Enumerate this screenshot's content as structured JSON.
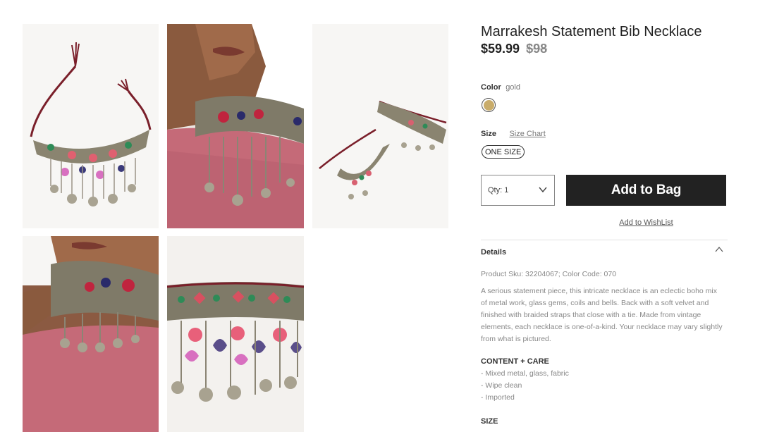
{
  "product": {
    "title": "Marrakesh Statement Bib Necklace",
    "price": "$59.99",
    "original_price": "$98"
  },
  "color": {
    "label": "Color",
    "selected": "gold",
    "swatch_hex": "#c9ac6a"
  },
  "size": {
    "label": "Size",
    "chart_link": "Size Chart",
    "option": "ONE SIZE"
  },
  "purchase": {
    "qty_label": "Qty: 1",
    "add_button": "Add to Bag",
    "wishlist_link": "Add to WishList"
  },
  "details": {
    "header": "Details",
    "sku": "Product Sku: 32204067; Color Code: 070",
    "description": "A serious statement piece, this intricate necklace is an eclectic boho mix of metal work, glass gems, coils and bells. Back with a soft velvet and finished with braided straps that close with a tie.  Made from vintage elements, each necklace is one-of-a-kind. Your necklace may vary slightly from what is pictured.",
    "content_care_header": "CONTENT + CARE",
    "care_items": [
      "- Mixed metal, glass, fabric",
      "- Wipe clean",
      "- Imported"
    ],
    "size_header": "SIZE"
  },
  "colors": {
    "button_bg": "#222222",
    "text_muted": "#888888"
  }
}
